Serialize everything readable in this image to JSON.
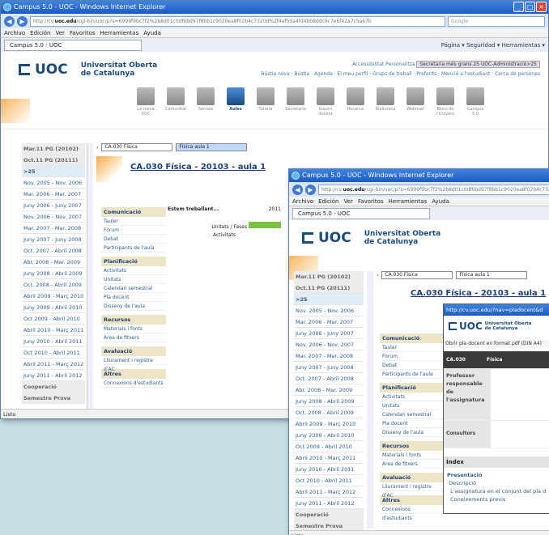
{
  "front": {
    "title": "Campus 5.0 - UOC - Windows Internet Explorer",
    "url_prefix": "http://cv.",
    "url_domain": "uoc.edu",
    "url_rest": "/cgi-bin/uoc/p?s=6999f9bc7f2%2b8d01c0df6bd97f8bb1c9020ea8f02b4c7320d%2f4ef5da4fd4bb8ddc9c7e6f42a7c5a67b",
    "search_placeholder": "Google",
    "menu": [
      "Archivo",
      "Edición",
      "Ver",
      "Favoritos",
      "Herramientas",
      "Ayuda"
    ],
    "tab": "Campus 5.0 - UOC",
    "commands": "Página ▾  Seguridad ▾  Herramientas ▾",
    "status": "Listo"
  },
  "uoc": {
    "brand": "UOC",
    "uni_line1": "Universitat Oberta",
    "uni_line2": "de Catalunya",
    "toplinks1": "Accessibilitat  Personalitza",
    "toplinks_sel": "Secretaria més grans 25  UOC-Administració>25",
    "toplinks2": "Bústia nova · Bústia · Agenda · El meu perfil · Grups de treball · Preferits · Menció a l'estudiant · Cerca de persones",
    "icons": [
      "La meva UOC",
      "Comunitat",
      "Serveis",
      "Aules",
      "Tutoria",
      "Secretaria",
      "Suport docent",
      "Recerca",
      "Biblioteca",
      "Webmail",
      "Blocs de l'Univers",
      "Campus 5.0"
    ]
  },
  "semesters": [
    {
      "label": "Mar.11 PG (20102)",
      "kind": "gray"
    },
    {
      "label": "Oct.11 PG (20111)",
      "kind": "gray"
    },
    {
      "label": ">25",
      "kind": "head"
    },
    {
      "label": "Nov. 2005 - Nov. 2006",
      "kind": ""
    },
    {
      "label": "Mar. 2006 - Mar. 2007",
      "kind": ""
    },
    {
      "label": "Juny 2006 - Juny 2007",
      "kind": ""
    },
    {
      "label": "Nov. 2006 - Nov. 2007",
      "kind": ""
    },
    {
      "label": "Mar. 2007 - Mar. 2008",
      "kind": ""
    },
    {
      "label": "Juny 2007 - Juny 2008",
      "kind": ""
    },
    {
      "label": "Oct. 2007 - Abril 2008",
      "kind": ""
    },
    {
      "label": "Abr. 2008 - Mar. 2009",
      "kind": ""
    },
    {
      "label": "Juny 2008 - Abril 2009",
      "kind": ""
    },
    {
      "label": "Oct. 2008 - Abril 2009",
      "kind": ""
    },
    {
      "label": "Abril 2009 - Març 2010",
      "kind": ""
    },
    {
      "label": "Juny 2009 - Abril 2010",
      "kind": ""
    },
    {
      "label": "Oct 2009 - Abril 2010",
      "kind": ""
    },
    {
      "label": "Abril 2010 - Març 2011",
      "kind": ""
    },
    {
      "label": "Juny 2010 - Abril 2011",
      "kind": ""
    },
    {
      "label": "Oct 2010 - Abril 2011",
      "kind": ""
    },
    {
      "label": "Abril 2011 - Març 2012",
      "kind": ""
    },
    {
      "label": "Juny 2011 - Abril 2012",
      "kind": ""
    },
    {
      "label": "Cooperació",
      "kind": "gray"
    },
    {
      "label": "Semestre Prova",
      "kind": "gray"
    }
  ],
  "course": {
    "crumb1": "CA.030 Física",
    "crumb2": "Física aula 1",
    "title": "CA.030 Física - 20103 - aula 1",
    "working": "Estem treballant...",
    "year": "2011",
    "units_label": "Unitats / Fases",
    "activities": "Activitats"
  },
  "sections": [
    {
      "header": "Comunicació",
      "items": [
        "Tauler",
        "Fòrum",
        "Debat",
        "Participants de l'aula"
      ]
    },
    {
      "header": "Planificació",
      "items": [
        "Activitats",
        "Unitats",
        "Calendari semestral",
        "Pla docent",
        "Disseny de l'aula"
      ]
    },
    {
      "header": "Recursos",
      "items": [
        "Materials i fonts",
        "Àrea de fitxers"
      ]
    },
    {
      "header": "Avaluació",
      "items": [
        "Lliurament i registre d'AC"
      ]
    },
    {
      "header": "Altres",
      "items": [
        "Connexions d'estudiants"
      ]
    }
  ],
  "popup": {
    "title": "http://cv.uoc.edu/?nav=pladocent&d",
    "pdf": "Obrir pla docent en format pdf (DIN A4)",
    "code": "CA.030",
    "name": "Física",
    "prof_label": "Professor responsable de l'assignatura",
    "consultors": "Consultors",
    "index": "Índex",
    "pres": "Presentació",
    "desc": "Descripció",
    "desc_text": "L'assignatura en el conjunt del pla d",
    "prev": "Coneixements previs"
  }
}
